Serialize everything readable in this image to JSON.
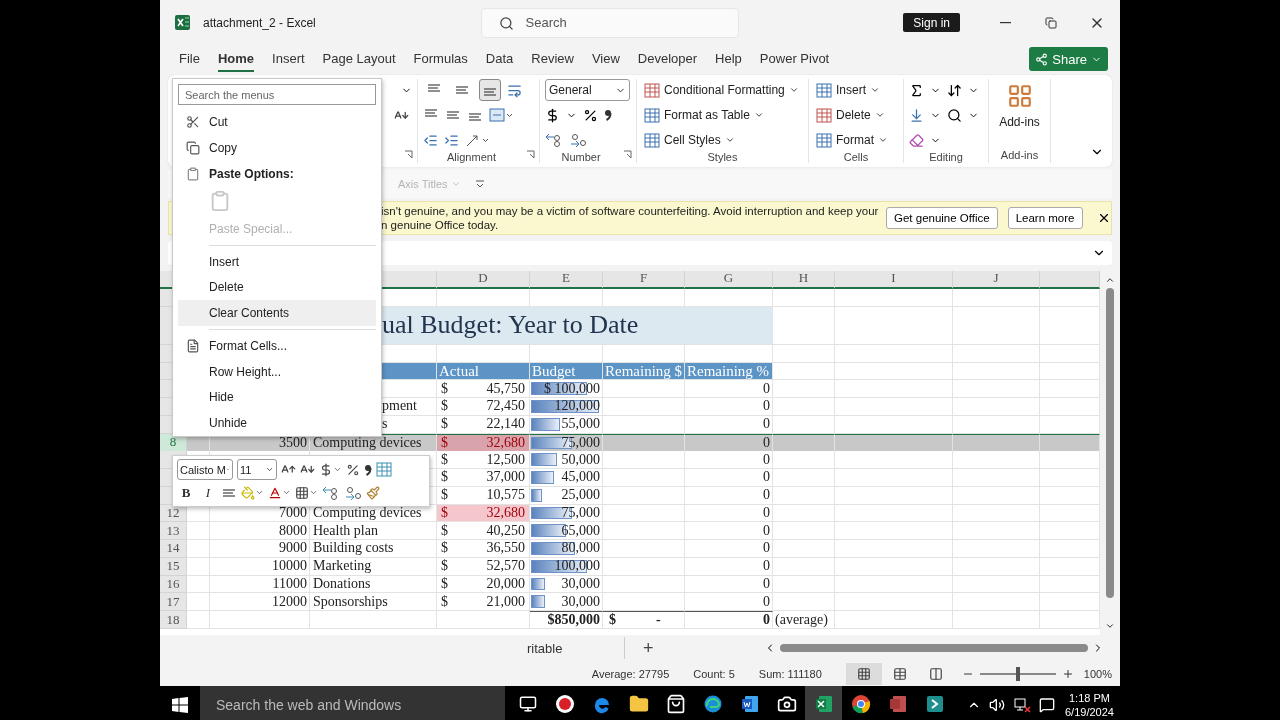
{
  "window": {
    "title": "attachment_2 - Excel",
    "search_placeholder": "Search",
    "sign_in": "Sign in"
  },
  "tabs": [
    {
      "label": "File",
      "selected": false
    },
    {
      "label": "Home",
      "selected": true
    },
    {
      "label": "Insert",
      "selected": false
    },
    {
      "label": "Page Layout",
      "selected": false
    },
    {
      "label": "Formulas",
      "selected": false
    },
    {
      "label": "Data",
      "selected": false
    },
    {
      "label": "Review",
      "selected": false
    },
    {
      "label": "View",
      "selected": false
    },
    {
      "label": "Developer",
      "selected": false
    },
    {
      "label": "Help",
      "selected": false
    },
    {
      "label": "Power Pivot",
      "selected": false
    }
  ],
  "share": "Share",
  "ribbon": {
    "alignment": {
      "label": "Alignment",
      "vertical_align": [
        {
          "selected": false
        },
        {
          "selected": false
        },
        {
          "selected": true
        }
      ]
    },
    "number": {
      "label": "Number",
      "format": "General"
    },
    "styles": {
      "label": "Styles",
      "buttons": [
        "Conditional Formatting",
        "Format as Table",
        "Cell Styles"
      ]
    },
    "cells": {
      "label": "Cells",
      "buttons": [
        "Insert",
        "Delete",
        "Format"
      ]
    },
    "editing": {
      "label": "Editing"
    },
    "add_ins": {
      "label": "Add-ins",
      "button": "Add-ins"
    }
  },
  "chart_tools": {
    "label": "Axis Titles",
    "disabled": true
  },
  "notice": {
    "lines": [
      "isn't genuine, and you may be a victim of software counterfeiting. Avoid interruption and keep your",
      "n genuine Office today."
    ],
    "buttons": [
      "Get genuine Office",
      "Learn more"
    ]
  },
  "sheet": {
    "columns": [
      "D",
      "E",
      "F",
      "G",
      "H",
      "I",
      "J"
    ],
    "rows": [
      {
        "kind": "blank"
      },
      {
        "kind": "title",
        "title": "ual Budget: Year to Date"
      },
      {
        "kind": "blank"
      },
      {
        "kind": "header",
        "labels": [
          "Actual",
          "Budget",
          "Remaining $",
          "Remaining %"
        ]
      },
      {
        "kind": "item",
        "currency": "$",
        "actual": "45,750",
        "budget": "$ 100,000",
        "level": 0.83,
        "percent": "0",
        "selected": false,
        "duplicate": false
      },
      {
        "kind": "item",
        "name": "pment",
        "cut": true,
        "currency": "$",
        "actual": "72,450",
        "budget": "120,000",
        "level": 1,
        "percent": "0",
        "selected": false,
        "duplicate": false
      },
      {
        "kind": "item",
        "name": "s",
        "cut": true,
        "currency": "$",
        "actual": "22,140",
        "budget": "55,000",
        "level": 0.46,
        "percent": "0",
        "selected": false,
        "duplicate": false
      },
      {
        "kind": "item",
        "number": "8",
        "code": "3500",
        "name": "Computing devices",
        "cut": false,
        "currency": "$",
        "actual": "32,680",
        "budget": "75,000",
        "level": 0.63,
        "percent": "0",
        "selected": true,
        "duplicate": true
      },
      {
        "kind": "item",
        "currency": "$",
        "actual": "12,500",
        "budget": "50,000",
        "level": 0.42,
        "percent": "0",
        "selected": false,
        "duplicate": false
      },
      {
        "kind": "item",
        "currency": "$",
        "actual": "37,000",
        "budget": "45,000",
        "level": 0.38,
        "percent": "0",
        "selected": false,
        "duplicate": false
      },
      {
        "kind": "item",
        "currency": "$",
        "actual": "10,575",
        "budget": "25,000",
        "level": 0.21,
        "percent": "0",
        "selected": false,
        "duplicate": false
      },
      {
        "kind": "item",
        "number": "12",
        "code": "7000",
        "name": "Computing devices",
        "cut": false,
        "currency": "$",
        "actual": "32,680",
        "budget": "75,000",
        "level": 0.63,
        "percent": "0",
        "selected": false,
        "duplicate": true
      },
      {
        "kind": "item",
        "number": "13",
        "code": "8000",
        "name": "Health plan",
        "cut": false,
        "currency": "$",
        "actual": "40,250",
        "budget": "65,000",
        "level": 0.54,
        "percent": "0",
        "selected": false,
        "duplicate": false
      },
      {
        "kind": "item",
        "number": "14",
        "code": "9000",
        "name": "Building costs",
        "cut": false,
        "currency": "$",
        "actual": "36,550",
        "budget": "80,000",
        "level": 0.67,
        "percent": "0",
        "selected": false,
        "duplicate": false
      },
      {
        "kind": "item",
        "number": "15",
        "code": "10000",
        "name": "Marketing",
        "cut": false,
        "currency": "$",
        "actual": "52,570",
        "budget": "100,000",
        "level": 0.83,
        "percent": "0",
        "selected": false,
        "duplicate": false
      },
      {
        "kind": "item",
        "number": "16",
        "code": "11000",
        "name": "Donations",
        "cut": false,
        "currency": "$",
        "actual": "20,000",
        "budget": "30,000",
        "level": 0.25,
        "percent": "0",
        "selected": false,
        "duplicate": false
      },
      {
        "kind": "item",
        "number": "17",
        "code": "12000",
        "name": "Sponsorships",
        "cut": false,
        "currency": "$",
        "actual": "21,000",
        "budget": "30,000",
        "level": 0.25,
        "percent": "0",
        "selected": false,
        "duplicate": false
      },
      {
        "kind": "total",
        "number": "18",
        "budget": "$850,000",
        "currency": "$",
        "remaining": "-",
        "percent": "0",
        "note": "(average)",
        "selected": false
      }
    ]
  },
  "context_menu": {
    "search_placeholder": "Search the menus",
    "items": [
      {
        "kind": "command",
        "label": "Cut",
        "disabled": false,
        "selected": false
      },
      {
        "kind": "command",
        "label": "Copy",
        "disabled": false,
        "selected": false
      },
      {
        "kind": "heading",
        "label": "Paste Options:"
      },
      {
        "kind": "paste_icon",
        "disabled": true
      },
      {
        "kind": "command",
        "label": "Paste Special...",
        "disabled": true,
        "selected": false
      },
      {
        "kind": "divider"
      },
      {
        "kind": "command",
        "label": "Insert",
        "disabled": false,
        "selected": false
      },
      {
        "kind": "command",
        "label": "Delete",
        "disabled": false,
        "selected": false
      },
      {
        "kind": "command",
        "label": "Clear Contents",
        "disabled": false,
        "selected": true
      },
      {
        "kind": "divider"
      },
      {
        "kind": "command",
        "label": "Format Cells...",
        "disabled": false,
        "selected": false
      },
      {
        "kind": "command",
        "label": "Row Height...",
        "disabled": false,
        "selected": false
      },
      {
        "kind": "command",
        "label": "Hide",
        "disabled": false,
        "selected": false
      },
      {
        "kind": "command",
        "label": "Unhide",
        "disabled": false,
        "selected": false
      }
    ]
  },
  "mini_toolbar": {
    "font": "Calisto M",
    "size": "11",
    "bold": "B",
    "italic": "I"
  },
  "sheet_tabs": {
    "tab": "ritable",
    "add": "+"
  },
  "status_bar": {
    "stats": [
      "Average: 27795",
      "Count: 5",
      "Sum: 111180"
    ],
    "zoom": {
      "level": 0.5,
      "reading": "100%"
    }
  },
  "taskbar": {
    "search_placeholder": "Search the web and Windows",
    "apps": [
      {
        "active": false
      },
      {
        "active": false
      },
      {
        "active": false
      },
      {
        "active": false
      },
      {
        "active": false
      },
      {
        "active": false
      },
      {
        "active": false
      },
      {
        "active": true
      },
      {
        "active": false
      },
      {
        "active": false
      },
      {
        "active": false
      }
    ],
    "time": "1:18 PM",
    "date": "6/19/2024"
  }
}
